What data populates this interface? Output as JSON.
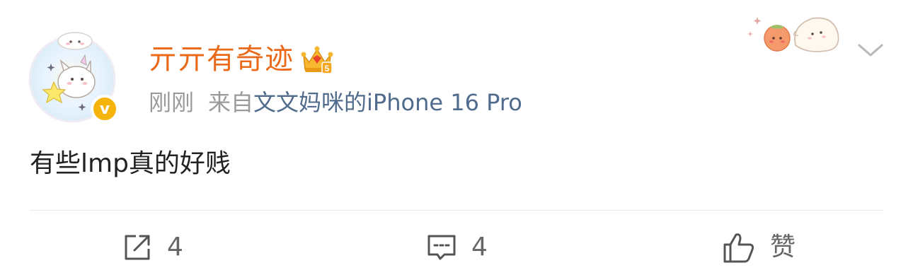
{
  "post": {
    "username": "亓亓有奇迹",
    "time": "刚刚",
    "source_prefix": "来自",
    "source_device": "文文妈咪的iPhone 16 Pro",
    "content": "有些lmp真的好贱",
    "avatar_verified_symbol": "v",
    "crown_level": "5"
  },
  "actions": {
    "repost_count": "4",
    "comment_count": "4",
    "like_label": "赞"
  },
  "colors": {
    "username": "#ea6a1c",
    "device_link": "#506b8c",
    "meta_gray": "#9a9a9a",
    "verified_badge": "#f5b40b"
  },
  "icons": {
    "repost": "repost-icon",
    "comment": "comment-icon",
    "like": "thumbs-up-icon",
    "menu": "chevron-down-icon",
    "crown": "crown-icon"
  }
}
